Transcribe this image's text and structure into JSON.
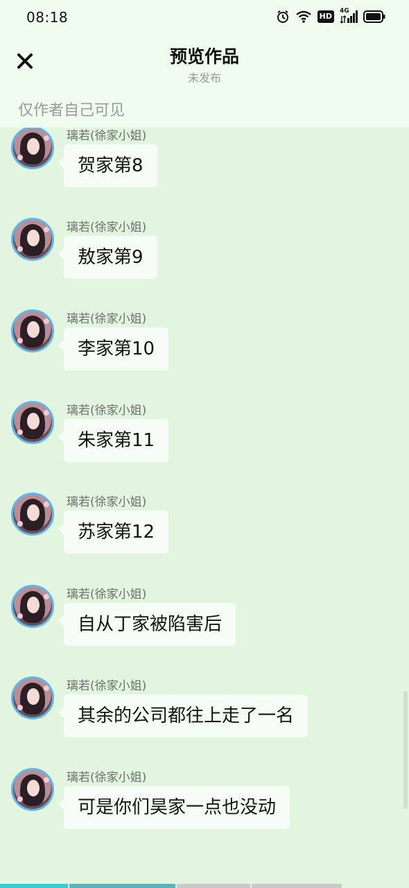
{
  "status_bar": {
    "time": "08:18",
    "icons": [
      "alarm-icon",
      "wifi-icon",
      "hd-icon",
      "signal-4g-icon",
      "battery-icon"
    ],
    "network_label": "4G",
    "hd_label": "HD"
  },
  "header": {
    "title": "预览作品",
    "subtitle": "未发布",
    "close_icon": "close-icon",
    "visibility_note": "仅作者自己可见"
  },
  "messages": [
    {
      "sender": "璃若(徐家小姐)",
      "text": "贺家第8"
    },
    {
      "sender": "璃若(徐家小姐)",
      "text": "敖家第9"
    },
    {
      "sender": "璃若(徐家小姐)",
      "text": "李家第10"
    },
    {
      "sender": "璃若(徐家小姐)",
      "text": "朱家第11"
    },
    {
      "sender": "璃若(徐家小姐)",
      "text": "苏家第12"
    },
    {
      "sender": "璃若(徐家小姐)",
      "text": "自从丁家被陷害后"
    },
    {
      "sender": "璃若(徐家小姐)",
      "text": "其余的公司都往上走了一名"
    },
    {
      "sender": "璃若(徐家小姐)",
      "text": "可是你们昊家一点也没动"
    }
  ],
  "colors": {
    "header_bg": "#f1fcf0",
    "chat_bg": "#e2f5de",
    "bubble_bg": "#f6fdf6",
    "avatar_ring": "#5fb6ea",
    "progress_done": "#3fc9d4",
    "progress_partial": "#5fb3b8",
    "progress_remaining": "#c9c9c9"
  },
  "reading_progress": {
    "segments": [
      {
        "fill": 0.166,
        "color": "#3fc9d4"
      },
      {
        "fill": 0.26,
        "color": "#5fb3b8"
      },
      {
        "fill": 0.18,
        "color": "#c9c9c9"
      },
      {
        "fill": 0.22,
        "color": "#c9c9c9"
      }
    ]
  }
}
